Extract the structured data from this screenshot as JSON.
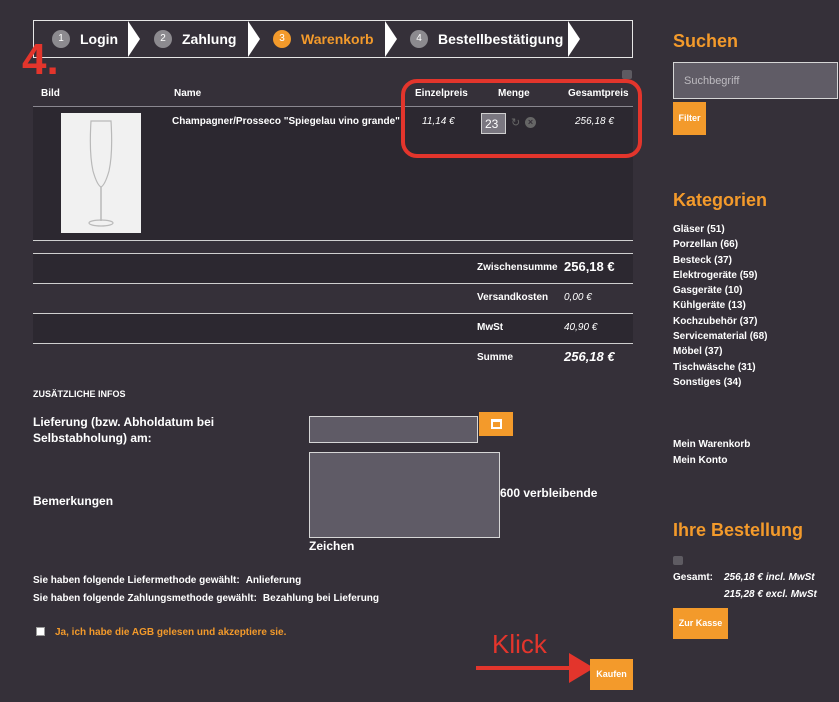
{
  "steps": [
    {
      "num": "1",
      "label": "Login"
    },
    {
      "num": "2",
      "label": "Zahlung"
    },
    {
      "num": "3",
      "label": "Warenkorb"
    },
    {
      "num": "4",
      "label": "Bestellbestätigung"
    }
  ],
  "step_marker": "4.",
  "table": {
    "headers": {
      "bild": "Bild",
      "name": "Name",
      "einzelpreis": "Einzelpreis",
      "menge": "Menge",
      "gesamtpreis": "Gesamtpreis"
    },
    "item": {
      "name": "Champagner/Prosseco \"Spiegelau vino grande\"",
      "einzelpreis": "11,14 €",
      "menge": "23",
      "gesamtpreis": "256,18 €"
    }
  },
  "totals": {
    "zwischensumme_label": "Zwischensumme",
    "zwischensumme": "256,18 €",
    "versand_label": "Versandkosten",
    "versand": "0,00 €",
    "mwst_label": "MwSt",
    "mwst": "40,90 €",
    "summe_label": "Summe",
    "summe": "256,18 €"
  },
  "extra": {
    "title": "ZUSÄTZLICHE INFOS",
    "lieferung_label": "Lieferung (bzw. Abholdatum bei Selbstabholung) am:",
    "bemerkungen_label": "Bemerkungen",
    "remaining": "600 verbleibende",
    "zeichen": "Zeichen",
    "liefermethode_text": "Sie haben folgende Liefermethode gewählt:",
    "liefermethode_value": "Anlieferung",
    "zahlungsmethode_text": "Sie haben folgende Zahlungsmethode gewählt:",
    "zahlungsmethode_value": "Bezahlung bei Lieferung",
    "agb": "Ja, ich habe die AGB gelesen und akzeptiere sie."
  },
  "annotation": {
    "klick": "Klick"
  },
  "kaufen": "Kaufen",
  "sidebar": {
    "suchen_title": "Suchen",
    "search_placeholder": "Suchbegriff",
    "filter": "Filter",
    "kategorien_title": "Kategorien",
    "categories": [
      "Gläser (51)",
      "Porzellan (66)",
      "Besteck (37)",
      "Elektrogeräte (59)",
      "Gasgeräte (10)",
      "Kühlgeräte (13)",
      "Kochzubehör (37)",
      "Servicematerial (68)",
      "Möbel (37)",
      "Tischwäsche (31)",
      "Sonstiges (34)"
    ],
    "mein_warenkorb": "Mein Warenkorb",
    "mein_konto": "Mein Konto",
    "bestellung_title": "Ihre Bestellung",
    "gesamt_label": "Gesamt:",
    "gesamt_incl": "256,18 € incl. MwSt",
    "gesamt_excl": "215,28 € excl. MwSt",
    "zur_kasse": "Zur Kasse"
  },
  "colors": {
    "accent": "#f39a2b",
    "annotation_red": "#e3352c",
    "background": "#353039"
  }
}
